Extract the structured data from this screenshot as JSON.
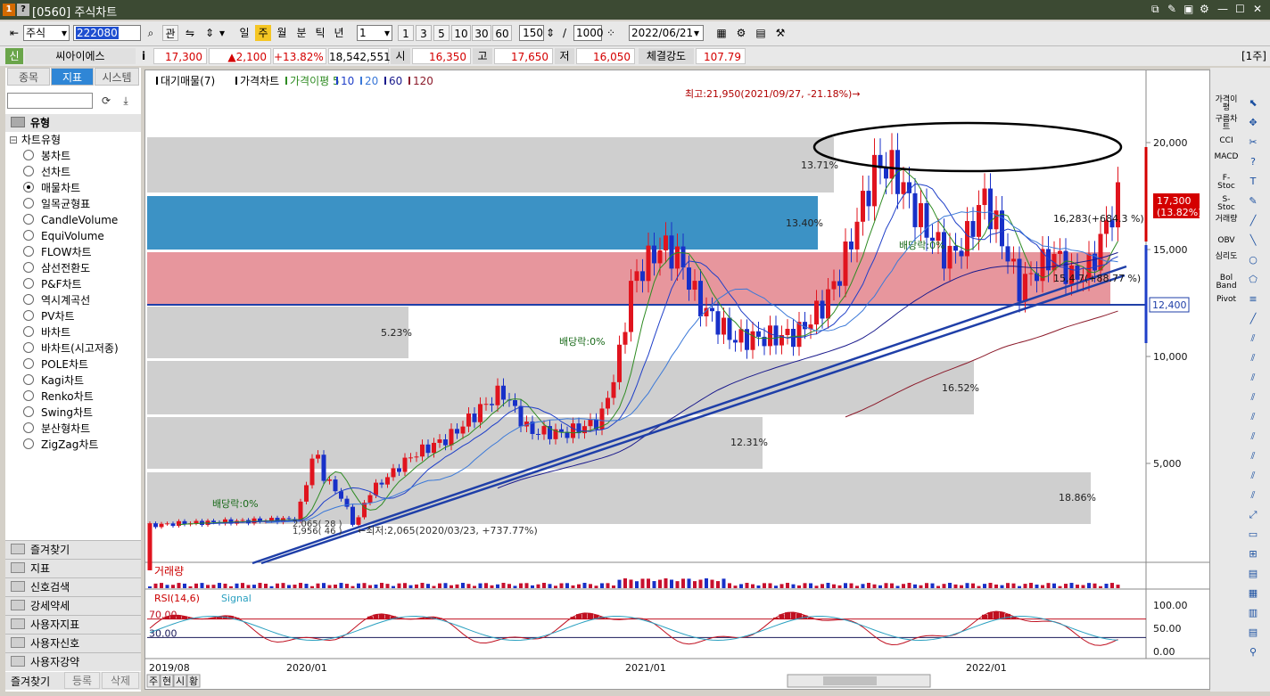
{
  "titlebar": {
    "title": "[0560] 주식차트",
    "icon1": "1",
    "icon2": "?"
  },
  "toolbar": {
    "market": "주식",
    "code": "222080",
    "rel_btn": "관",
    "periods": [
      "일",
      "주",
      "월",
      "분",
      "틱",
      "년"
    ],
    "active_period": "주",
    "count_select": "1",
    "quick_counts": [
      "1",
      "3",
      "5",
      "10",
      "30",
      "60"
    ],
    "bars": "150",
    "total": "1000",
    "slash": "/",
    "date": "2022/06/21"
  },
  "quote": {
    "badge": "신",
    "name": "씨아이에스",
    "info": "i",
    "price": "17,300",
    "change": "▲2,100",
    "rate": "+13.82%",
    "volume": "18,542,551",
    "open_label": "시",
    "open": "16,350",
    "high_label": "고",
    "high": "17,650",
    "low_label": "저",
    "low": "16,050",
    "strength_label": "체결강도",
    "strength": "107.79",
    "page": "[1주]"
  },
  "sidebar": {
    "tabs": [
      "종목",
      "지표",
      "시스템"
    ],
    "active_tab": "지표",
    "section": "유형",
    "group": "차트유형",
    "items": [
      "봉차트",
      "선차트",
      "매물차트",
      "일목균형표",
      "CandleVolume",
      "EquiVolume",
      "FLOW차트",
      "삼선전환도",
      "P&F차트",
      "역시계곡선",
      "PV차트",
      "바차트",
      "바차트(시고저종)",
      "POLE차트",
      "Kagi차트",
      "Renko차트",
      "Swing차트",
      "분산형차트",
      "ZigZag차트"
    ],
    "selected": "매물차트",
    "folders": [
      "즐겨찾기",
      "지표",
      "신호검색",
      "강세약세",
      "사용자지표",
      "사용자신호",
      "사용자강약"
    ],
    "bottom": [
      "즐겨찾기",
      "등록",
      "삭제"
    ]
  },
  "chart": {
    "legend": [
      "대기매물(7)",
      "가격차트",
      "가격이평 5",
      "10",
      "20",
      "60",
      "120"
    ],
    "legend_colors": [
      "#000000",
      "#000000",
      "#2e8b22",
      "#1f3fc8",
      "#3a78d8",
      "#1a1a8c",
      "#8b1a2a"
    ],
    "annotations": {
      "high": "최고:21,950(2021/09/27, -21.18%)→",
      "low": "←최저:2,065(2020/03/23, +737.77%)",
      "div1": "배당락:0%",
      "div2": "배당락:0%",
      "div3": "배당락:0%",
      "ma_label1": "16,283(+684.3 %)",
      "ma_label2": "15,4 7(+88.77 %)",
      "small_left": "2,065( 28 )\n1,956( 46 )"
    },
    "price_axis": [
      "20,000",
      "15,000",
      "10,000",
      "5,000"
    ],
    "price_tag": "17,300",
    "price_tag_rate": "(13.82%)",
    "line_tag": "12,400",
    "date_axis": [
      "2019/08",
      "2020/01",
      "2021/01",
      "2022/01"
    ],
    "volume_title": "거래량",
    "rsi_title": "RSI(14,6)",
    "rsi_signal": "Signal",
    "rsi_levels": [
      "70.00",
      "30.00"
    ],
    "rsi_axis": [
      "100.00",
      "50.00",
      "0.00"
    ],
    "profile_pcts": [
      "13.71%",
      "13.40%",
      "5.23%",
      "16.52%",
      "12.31%",
      "18.86%"
    ]
  },
  "bottombar": {
    "left_buttons": [
      "주",
      "현",
      "시",
      "황"
    ]
  },
  "rightbar": {
    "labels": [
      "가격이평",
      "구름차트",
      "CCI",
      "MACD",
      "F-Stoc",
      "S-Stoc",
      "거래량",
      "OBV",
      "심리도",
      "Bol Band",
      "Pivot"
    ]
  },
  "chart_data": {
    "type": "candlestick",
    "x_ticks": [
      "2019/08",
      "2020/01",
      "2021/01",
      "2022/01"
    ],
    "ylim": [
      0,
      22500
    ],
    "y_ticks": [
      5000,
      10000,
      15000,
      20000
    ],
    "annotations": {
      "max": 21950,
      "max_date": "2021/09/27",
      "min": 2065,
      "min_date": "2020/03/23"
    },
    "close_last": 17300,
    "horizontal_line": 12400,
    "volume_profile_pct": [
      18.86,
      12.31,
      16.52,
      5.23,
      13.71,
      13.4,
      13.71
    ],
    "rsi": {
      "period": 14,
      "signal": 6,
      "upper": 70,
      "lower": 30
    }
  }
}
